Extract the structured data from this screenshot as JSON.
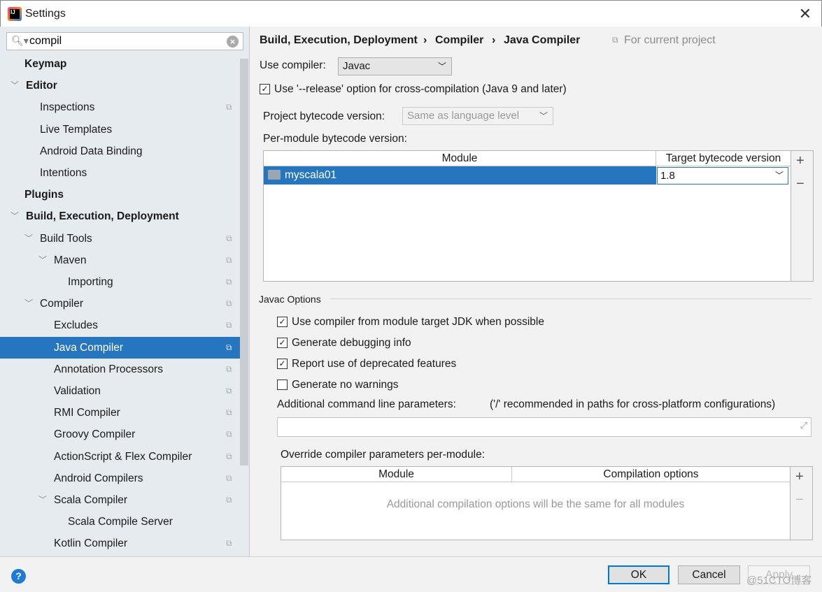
{
  "window": {
    "title": "Settings",
    "close": "✕"
  },
  "search": {
    "value": "compil"
  },
  "sidebar": {
    "items": [
      {
        "label": "Keymap",
        "level": 0,
        "bold": true,
        "arrow": false,
        "copy": false
      },
      {
        "label": "Editor",
        "level": 0,
        "bold": true,
        "arrow": true,
        "copy": false
      },
      {
        "label": "Inspections",
        "level": 1,
        "arrow": false,
        "copy": true
      },
      {
        "label": "Live Templates",
        "level": 1,
        "arrow": false,
        "copy": false
      },
      {
        "label": "Android Data Binding",
        "level": 1,
        "arrow": false,
        "copy": false
      },
      {
        "label": "Intentions",
        "level": 1,
        "arrow": false,
        "copy": false
      },
      {
        "label": "Plugins",
        "level": 0,
        "bold": true,
        "arrow": false,
        "copy": false
      },
      {
        "label": "Build, Execution, Deployment",
        "level": 0,
        "bold": true,
        "arrow": true,
        "copy": false
      },
      {
        "label": "Build Tools",
        "level": 1,
        "arrow": true,
        "copy": true
      },
      {
        "label": "Maven",
        "level": 2,
        "arrow": true,
        "copy": true
      },
      {
        "label": "Importing",
        "level": 3,
        "arrow": false,
        "copy": true
      },
      {
        "label": "Compiler",
        "level": 1,
        "arrow": true,
        "copy": true
      },
      {
        "label": "Excludes",
        "level": 2,
        "arrow": false,
        "copy": true
      },
      {
        "label": "Java Compiler",
        "level": 2,
        "arrow": false,
        "copy": true,
        "selected": true
      },
      {
        "label": "Annotation Processors",
        "level": 2,
        "arrow": false,
        "copy": true
      },
      {
        "label": "Validation",
        "level": 2,
        "arrow": false,
        "copy": true
      },
      {
        "label": "RMI Compiler",
        "level": 2,
        "arrow": false,
        "copy": true
      },
      {
        "label": "Groovy Compiler",
        "level": 2,
        "arrow": false,
        "copy": true
      },
      {
        "label": "ActionScript & Flex Compiler",
        "level": 2,
        "arrow": false,
        "copy": true
      },
      {
        "label": "Android Compilers",
        "level": 2,
        "arrow": false,
        "copy": true
      },
      {
        "label": "Scala Compiler",
        "level": 2,
        "arrow": true,
        "copy": true
      },
      {
        "label": "Scala Compile Server",
        "level": 3,
        "arrow": false,
        "copy": false
      },
      {
        "label": "Kotlin Compiler",
        "level": 2,
        "arrow": false,
        "copy": true
      }
    ]
  },
  "breadcrumb": {
    "items": [
      "Build, Execution, Deployment",
      "Compiler",
      "Java Compiler"
    ],
    "sep": "›",
    "scope": "For current project"
  },
  "main": {
    "use_compiler_label": "Use compiler:",
    "use_compiler_value": "Javac",
    "release_option": {
      "label": "Use '--release' option for cross-compilation (Java 9 and later)",
      "checked": true
    },
    "project_bytecode_label": "Project bytecode version:",
    "project_bytecode_value": "Same as language level",
    "per_module_label": "Per-module bytecode version:",
    "module_table": {
      "headers": [
        "Module",
        "Target bytecode version"
      ],
      "rows": [
        {
          "module": "myscala01",
          "version": "1.8"
        }
      ]
    },
    "javac_options_title": "Javac Options",
    "options": [
      {
        "label": "Use compiler from module target JDK when possible",
        "checked": true
      },
      {
        "label": "Generate debugging info",
        "checked": true
      },
      {
        "label": "Report use of deprecated features",
        "checked": true
      },
      {
        "label": "Generate no warnings",
        "checked": false
      }
    ],
    "additional_label": "Additional command line parameters:",
    "additional_hint": "('/' recommended in paths for cross-platform configurations)",
    "additional_value": "",
    "override_label": "Override compiler parameters per-module:",
    "override_table": {
      "headers": [
        "Module",
        "Compilation options"
      ],
      "empty": "Additional compilation options will be the same for all modules"
    }
  },
  "footer": {
    "help": "?",
    "ok": "OK",
    "cancel": "Cancel",
    "apply": "Apply",
    "watermark": "@51CTO博客"
  },
  "colors": {
    "selection": "#2675bf",
    "sidebar_bg": "#e6ebf0",
    "focus": "#0078d7"
  }
}
